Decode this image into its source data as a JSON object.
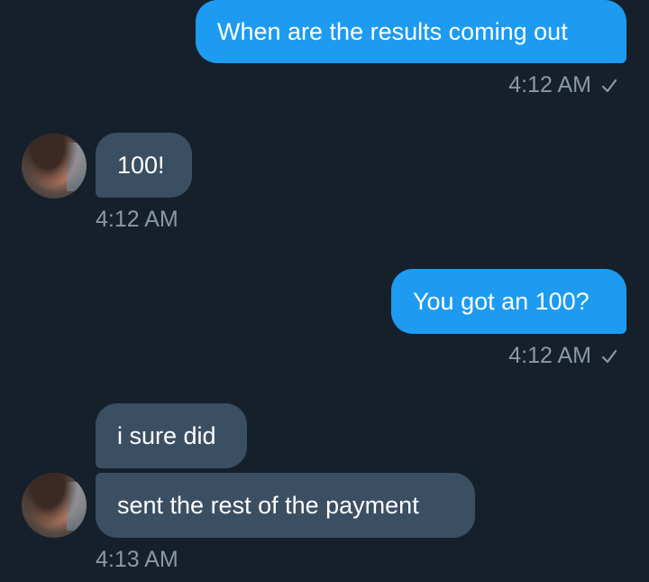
{
  "messages": [
    {
      "text": "When are the results coming out",
      "time": "4:12 AM",
      "direction": "out",
      "status": "sent-check"
    },
    {
      "text": "100!",
      "time": "4:12 AM",
      "direction": "in"
    },
    {
      "text": "You got an 100?",
      "time": "4:12 AM",
      "direction": "out",
      "status": "sent-check"
    },
    {
      "text": "i sure did",
      "direction": "in"
    },
    {
      "text": "sent the rest of the payment",
      "time": "4:13 AM",
      "direction": "in"
    }
  ],
  "icons": {
    "read_status": "checkmark-icon",
    "contact_avatar": "avatar"
  },
  "colors": {
    "background": "#15202b",
    "outgoing_bubble": "#1d9bf0",
    "incoming_bubble": "#3b4f63",
    "timestamp": "#8b98a5",
    "text": "#ffffff"
  }
}
